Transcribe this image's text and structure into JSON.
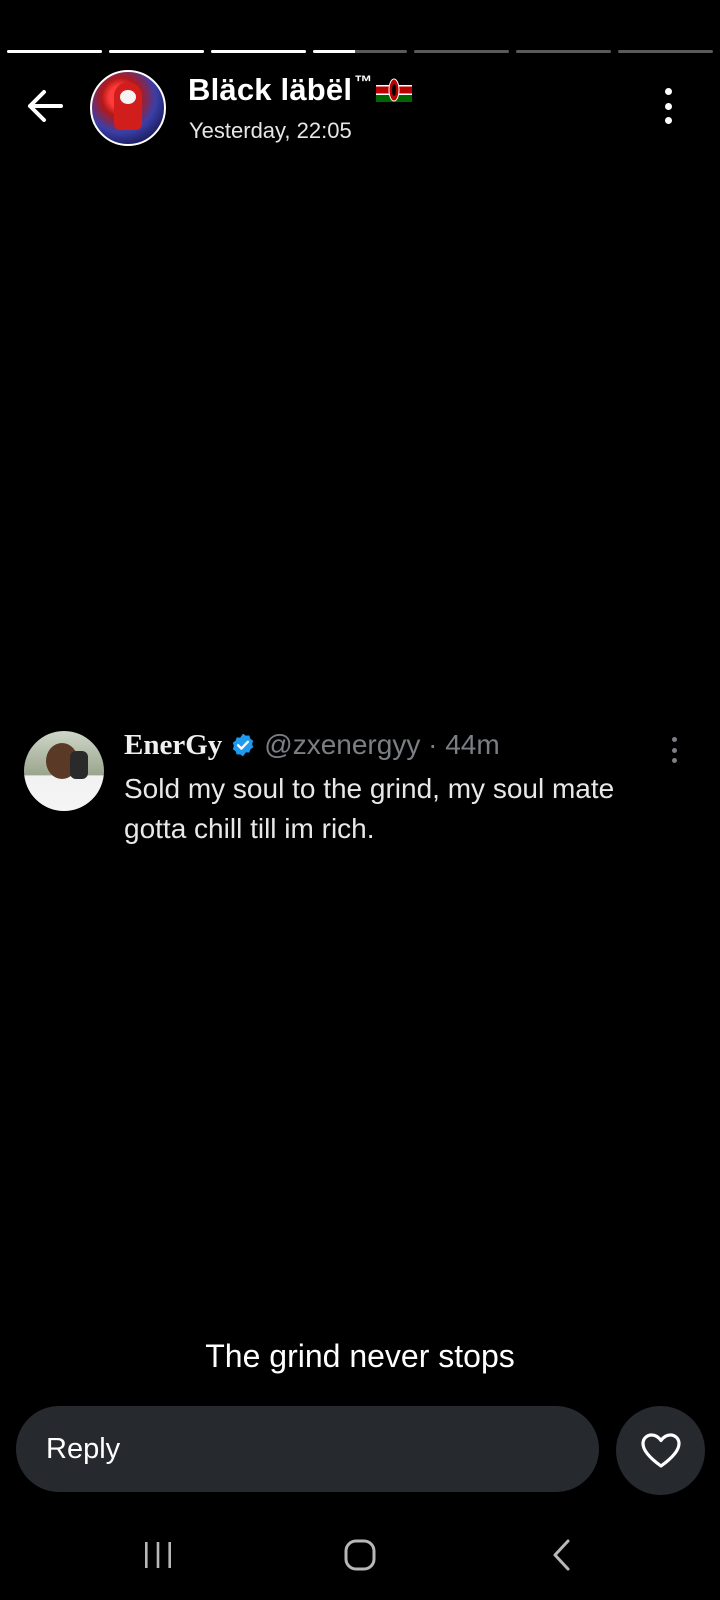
{
  "story": {
    "segments_total": 7,
    "segments_completed": 3,
    "current_segment_progress": 0.45
  },
  "header": {
    "name": "Bläck läbël",
    "trademark": "™",
    "flag_icon": "kenya-flag-icon",
    "time": "Yesterday, 22:05"
  },
  "tweet": {
    "name": "EnerGy",
    "verified": true,
    "handle_time": "@zxenergyy · 44m",
    "text": "Sold my soul to the grind, my soul mate gotta chill till im rich."
  },
  "caption": "The grind never stops",
  "reply": {
    "label": "Reply"
  },
  "icons": {
    "back": "back-arrow-icon",
    "more": "more-vertical-icon",
    "like": "heart-icon",
    "nav_recents": "recents-icon",
    "nav_home": "home-icon",
    "nav_back": "nav-back-icon"
  },
  "colors": {
    "background": "#000000",
    "input_bg": "#262a2f",
    "verified_blue": "#1d9bf0",
    "muted_text": "#7b7f84"
  }
}
